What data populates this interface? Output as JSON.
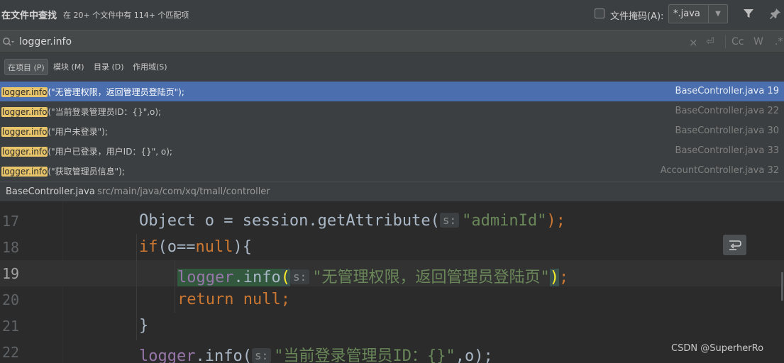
{
  "header": {
    "title": "在文件中查找",
    "summary": "在 20+ 个文件中有 114+ 个匹配项",
    "file_mask_label": "文件掩码(A):",
    "file_mask_value": "*.java",
    "file_mask_checked": false
  },
  "search": {
    "query": "logger.info",
    "options": [
      "Cc",
      "W",
      ".*"
    ]
  },
  "scopes": [
    {
      "label": "在项目 (P)",
      "active": true
    },
    {
      "label": "模块 (M)",
      "active": false
    },
    {
      "label": "目录 (D)",
      "active": false
    },
    {
      "label": "作用域(S)",
      "active": false
    }
  ],
  "results": [
    {
      "match": "logger.info",
      "rest": "(\"无管理权限，返回管理员登陆页\");",
      "file": "BaseController.java 19",
      "selected": true
    },
    {
      "match": "logger.info",
      "rest": "(\"当前登录管理员ID：{}\",o);",
      "file": "BaseController.java 22",
      "selected": false
    },
    {
      "match": "logger.info",
      "rest": "(\"用户未登录\");",
      "file": "BaseController.java 30",
      "selected": false
    },
    {
      "match": "logger.info",
      "rest": "(\"用户已登录，用户ID：{}\", o);",
      "file": "BaseController.java 33",
      "selected": false
    },
    {
      "match": "logger.info",
      "rest": "(\"获取管理员信息\");",
      "file": "AccountController.java 32",
      "selected": false
    }
  ],
  "preview_path": {
    "file": "BaseController.java",
    "directory": "src/main/java/com/xq/tmall/controller"
  },
  "editor": {
    "current_line": "19",
    "lines": [
      {
        "number": "17"
      },
      {
        "number": "18"
      },
      {
        "number": "19"
      },
      {
        "number": "20"
      },
      {
        "number": "21"
      },
      {
        "number": "22"
      }
    ],
    "code": {
      "l17_a": "Object o = session.getAttribute(",
      "l17_hint": "s:",
      "l17_str": "\"adminId\"",
      "l17_end": ");",
      "l18_kw": "if",
      "l18_a": "(o==",
      "l18_null": "null",
      "l18_end": "){",
      "l19_field": "logger",
      "l19_dot": ".info",
      "l19_open": "(",
      "l19_hint": "s:",
      "l19_str": "\"无管理权限，返回管理员登陆页\"",
      "l19_close": ")",
      "l19_semi": ";",
      "l20_return": "return",
      "l20_null": "null",
      "l20_semi": ";",
      "l21": "}",
      "l22_field": "logger",
      "l22_method": ".info(",
      "l22_hint": "s:",
      "l22_str": "\"当前登录管理员ID：{}\"",
      "l22_end": ",o);"
    }
  },
  "watermark": "CSDN @SuperherRo",
  "colors": {
    "selection": "#4b6eaf",
    "match_highlight": "#e8c46a",
    "keyword": "#cc7832",
    "string": "#6a8759",
    "field": "#9876aa"
  }
}
